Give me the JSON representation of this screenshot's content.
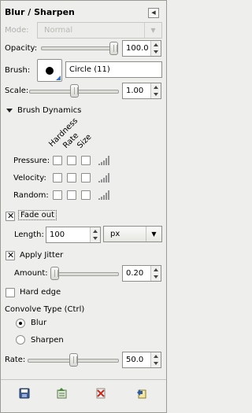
{
  "title": "Blur / Sharpen",
  "mode": {
    "label": "Mode:",
    "value": "Normal"
  },
  "opacity": {
    "label": "Opacity:",
    "value": "100.0",
    "fraction": 1.0
  },
  "brush": {
    "label": "Brush:",
    "value": "Circle (11)"
  },
  "scale": {
    "label": "Scale:",
    "value": "1.00",
    "fraction": 0.5
  },
  "brush_dynamics": {
    "label": "Brush Dynamics",
    "columns": [
      "Hardness",
      "Rate",
      "Size"
    ],
    "rows": [
      "Pressure:",
      "Velocity:",
      "Random:"
    ]
  },
  "fade_out": {
    "label": "Fade out",
    "checked": true
  },
  "length": {
    "label": "Length:",
    "value": "100",
    "unit": "px"
  },
  "apply_jitter": {
    "label": "Apply Jitter",
    "checked": true
  },
  "amount": {
    "label": "Amount:",
    "value": "0.20",
    "fraction": 0.0
  },
  "hard_edge": {
    "label": "Hard edge",
    "checked": false
  },
  "convolve": {
    "label": "Convolve Type  (Ctrl)",
    "options": [
      "Blur",
      "Sharpen"
    ],
    "selected": "Blur"
  },
  "rate": {
    "label": "Rate:",
    "value": "50.0",
    "fraction": 0.5
  },
  "icons": {
    "panel_menu": "tab-menu-icon",
    "save": "save-icon",
    "restore": "restore-icon",
    "delete": "delete-icon",
    "reset": "reset-icon"
  }
}
